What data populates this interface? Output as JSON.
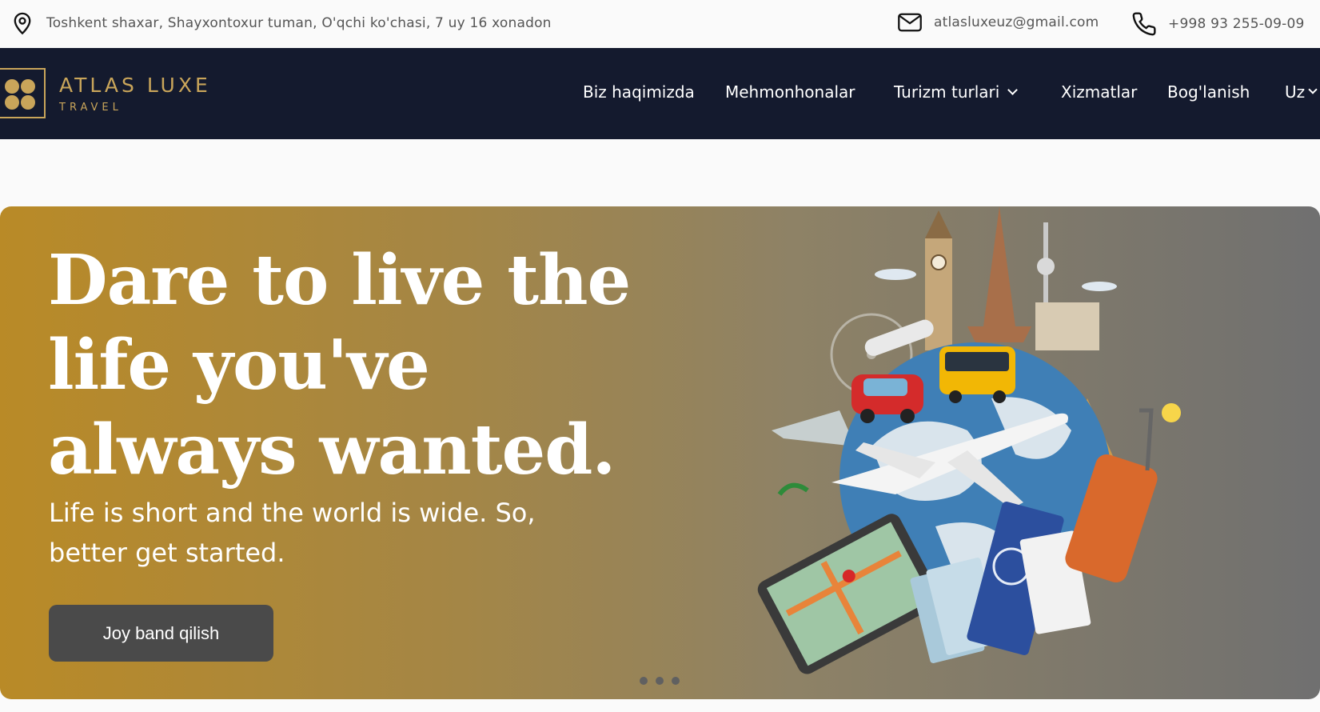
{
  "contact": {
    "address": "Toshkent shaxar, Shayxontoxur tuman, O'qchi ko'chasi, 7 uy 16 xonadon",
    "email": "atlasluxeuz@gmail.com",
    "phone": "+998 93 255-09-09"
  },
  "brand": {
    "title": "ATLAS LUXE",
    "subtitle": "TRAVEL",
    "color": "#c9a55a"
  },
  "nav": {
    "items": [
      {
        "label": "Biz haqimizda"
      },
      {
        "label": "Mehmonhonalar"
      },
      {
        "label": "Turizm turlari"
      },
      {
        "label": "Xizmatlar"
      },
      {
        "label": "Bog'lanish"
      },
      {
        "label": "Uz"
      }
    ]
  },
  "hero": {
    "title": "Dare to live the life you've always wanted.",
    "subtitle": "Life is short and the world is wide. So, better get started.",
    "cta": "Joy band qilish",
    "slides": 3
  },
  "icons": {
    "address": "map-pin-icon",
    "email": "envelope-icon",
    "phone": "phone-icon"
  }
}
